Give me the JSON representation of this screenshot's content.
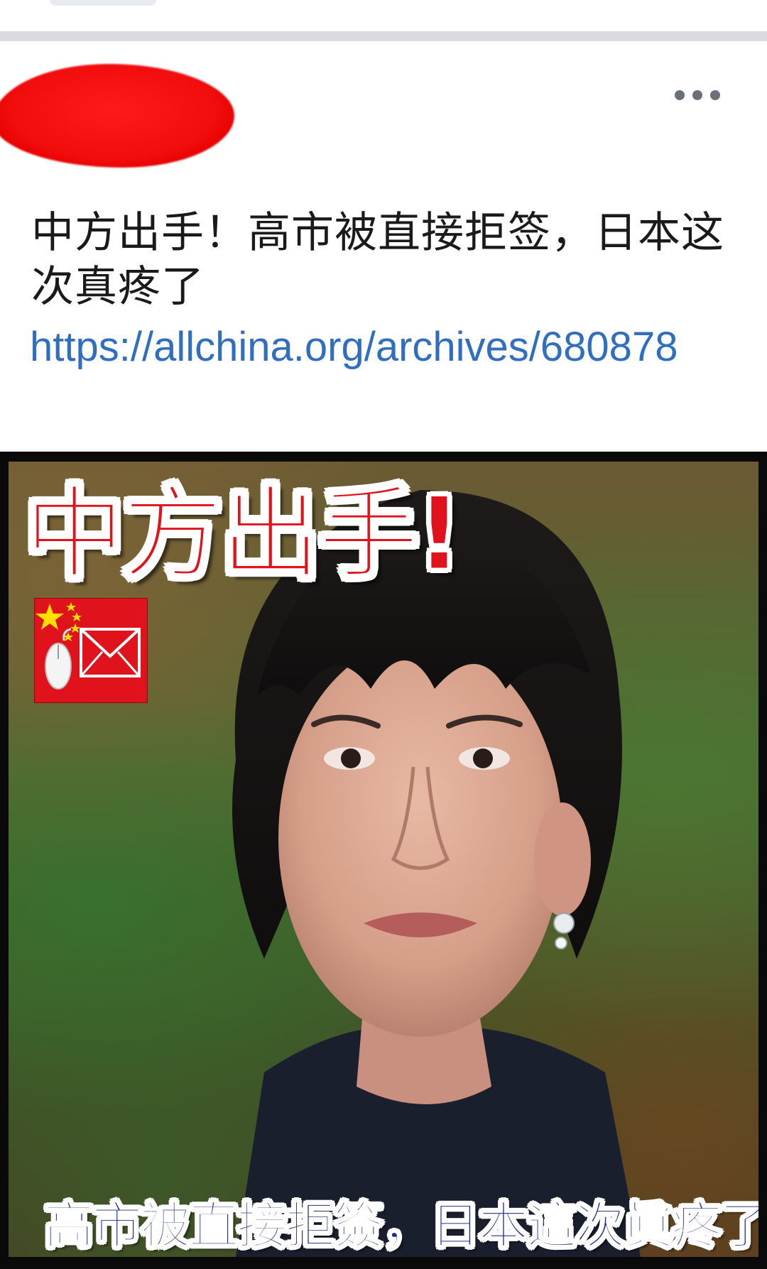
{
  "post": {
    "title": "中方出手！高市被直接拒签，日本这次真疼了",
    "link": "https://allchina.org/archives/680878",
    "more_icon": "more-horizontal-icon",
    "author_redacted": true
  },
  "image": {
    "headline": "中方出手!",
    "caption": "高市被直接拒簽，日本這次眞疼了!",
    "badge_icon": "china-flag-mail-icon"
  },
  "colors": {
    "link": "#2f6ec0",
    "headline_red": "#e0121b",
    "caption_blue": "#1b2a8a",
    "redaction_red": "#f20d0d"
  }
}
